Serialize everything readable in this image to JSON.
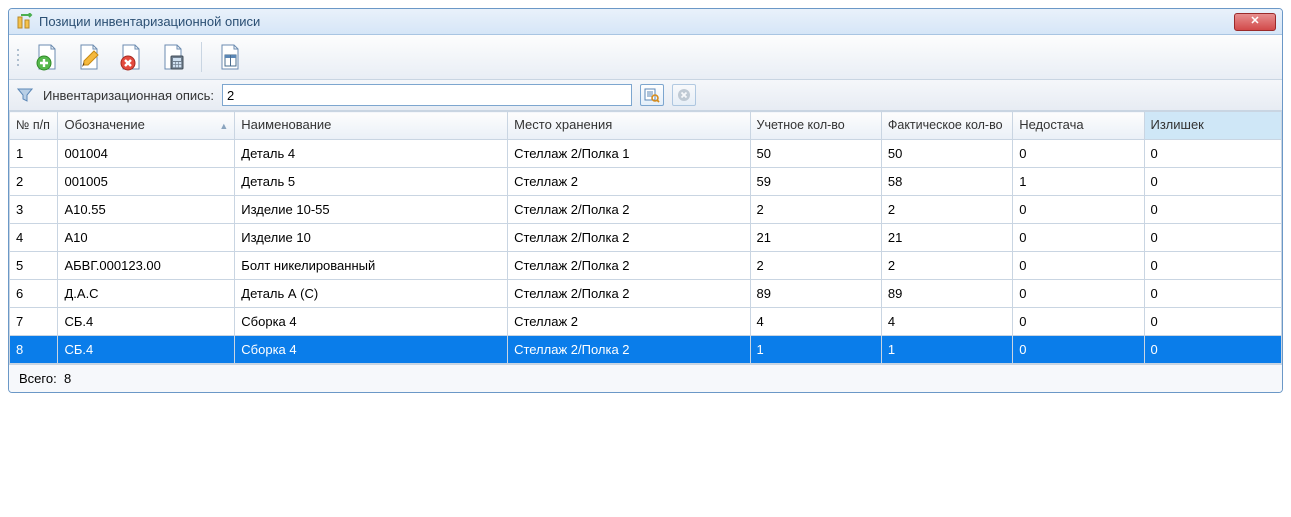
{
  "window": {
    "title": "Позиции инвентаризационной описи"
  },
  "toolbar": {
    "add": "add",
    "edit": "edit",
    "delete": "delete",
    "calc": "calc",
    "columns": "columns"
  },
  "filter": {
    "label": "Инвентаризационная опись:",
    "value": "2",
    "lookup_tip": "lookup",
    "clear_tip": "clear"
  },
  "columns": {
    "idx": "№\nп/п",
    "code": "Обозначение",
    "name": "Наименование",
    "loc": "Место хранения",
    "qty_acc": "Учетное\nкол-во",
    "qty_fact": "Фактическое\nкол-во",
    "shortage": "Недостача",
    "surplus": "Излишек"
  },
  "rows": [
    {
      "idx": "1",
      "code": "001004",
      "name": "Деталь 4",
      "loc": "Стеллаж 2/Полка 1",
      "acc": "50",
      "fact": "50",
      "short": "0",
      "over": "0"
    },
    {
      "idx": "2",
      "code": "001005",
      "name": "Деталь 5",
      "loc": "Стеллаж 2",
      "acc": "59",
      "fact": "58",
      "short": "1",
      "over": "0"
    },
    {
      "idx": "3",
      "code": "А10.55",
      "name": "Изделие 10-55",
      "loc": "Стеллаж 2/Полка 2",
      "acc": "2",
      "fact": "2",
      "short": "0",
      "over": "0"
    },
    {
      "idx": "4",
      "code": "А10",
      "name": "Изделие 10",
      "loc": "Стеллаж 2/Полка 2",
      "acc": "21",
      "fact": "21",
      "short": "0",
      "over": "0"
    },
    {
      "idx": "5",
      "code": "АБВГ.000123.00",
      "name": "Болт никелированный",
      "loc": "Стеллаж 2/Полка 2",
      "acc": "2",
      "fact": "2",
      "short": "0",
      "over": "0"
    },
    {
      "idx": "6",
      "code": "Д.А.С",
      "name": "Деталь А (С)",
      "loc": "Стеллаж 2/Полка 2",
      "acc": "89",
      "fact": "89",
      "short": "0",
      "over": "0"
    },
    {
      "idx": "7",
      "code": "СБ.4",
      "name": "Сборка 4",
      "loc": "Стеллаж 2",
      "acc": "4",
      "fact": "4",
      "short": "0",
      "over": "0"
    },
    {
      "idx": "8",
      "code": "СБ.4",
      "name": "Сборка 4",
      "loc": "Стеллаж 2/Полка 2",
      "acc": "1",
      "fact": "1",
      "short": "0",
      "over": "0"
    }
  ],
  "selected_row": 7,
  "footer": {
    "label": "Всего:",
    "value": "8"
  }
}
